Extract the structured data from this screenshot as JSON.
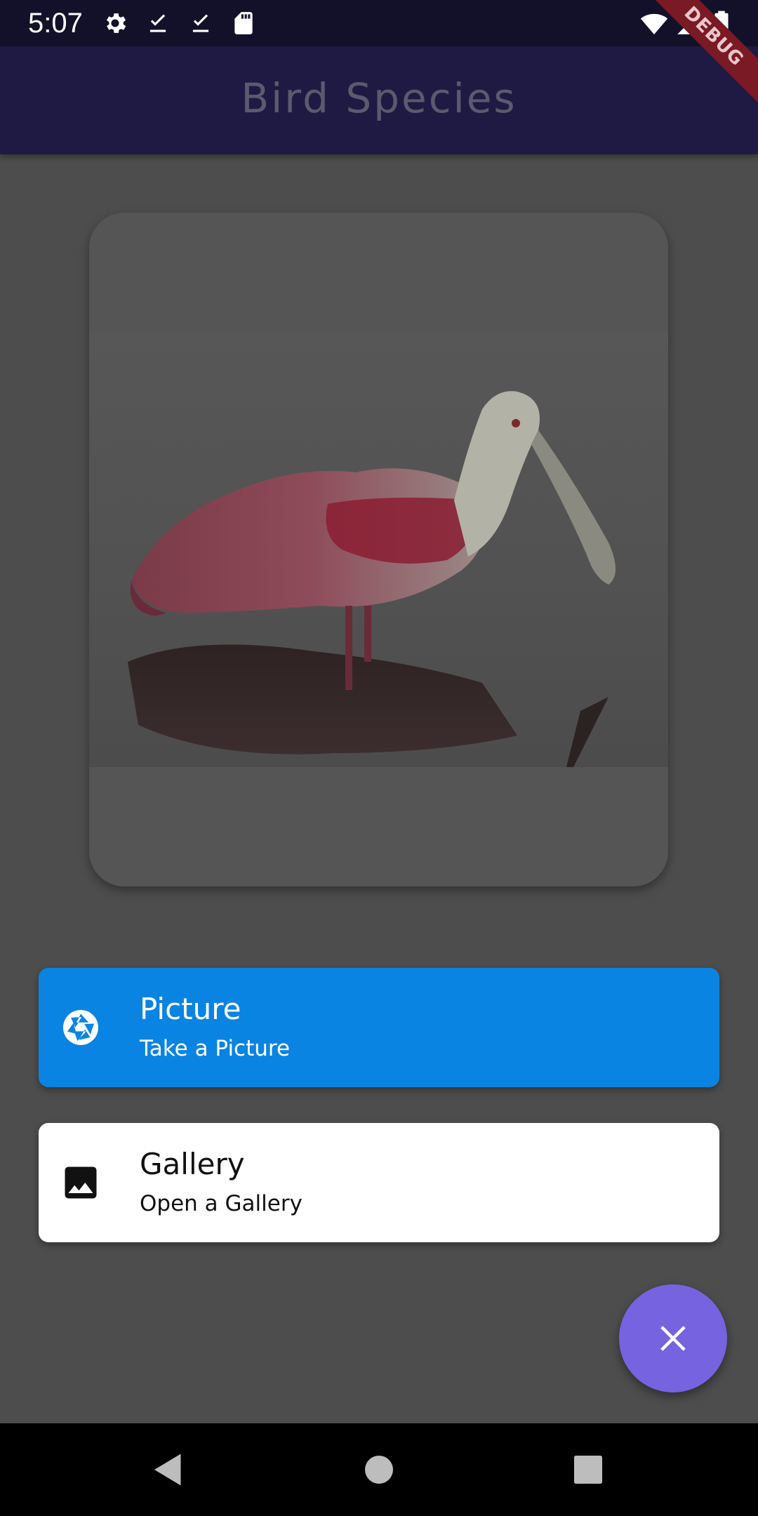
{
  "status_bar": {
    "time": "5:07",
    "left_icons": [
      "gear-icon",
      "download-done-icon",
      "download-done-icon",
      "sd-card-icon"
    ],
    "right_icons": [
      "wifi-icon",
      "signal-icon",
      "battery-icon"
    ]
  },
  "app_bar": {
    "title": "Bird Species",
    "debug_label": "DEBUG"
  },
  "image_card": {
    "image_icon": "bird-photo"
  },
  "actions": [
    {
      "icon": "camera-aperture-icon",
      "title": "Picture",
      "subtitle": "Take a Picture",
      "background": "#0a84e2"
    },
    {
      "icon": "image-icon",
      "title": "Gallery",
      "subtitle": "Open a Gallery",
      "background": "#ffffff"
    }
  ],
  "fab": {
    "icon": "close-icon",
    "color": "#7563e0"
  },
  "nav_bar": {
    "buttons": [
      "back-icon",
      "home-icon",
      "recents-icon"
    ]
  },
  "colors": {
    "status_bar": "#13112a",
    "app_bar": "#1f1a43",
    "scrim_background": "#4d4d4d",
    "debug_ribbon": "#7a1a24"
  }
}
